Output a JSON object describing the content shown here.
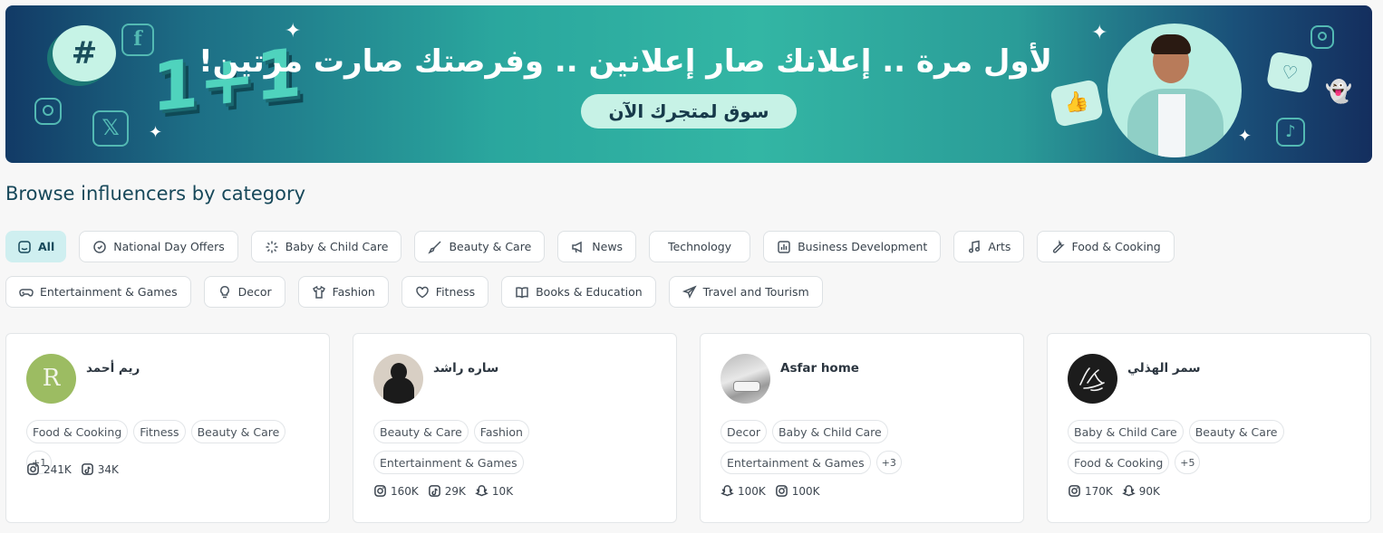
{
  "banner": {
    "headline": "لأول مرة .. إعلانك صار إعلانين .. وفرصتك صارت مرتين!",
    "cta_label": "سوق لمتجرك الآن",
    "promo_badge": "1+1",
    "hash_symbol": "#",
    "social_icons": [
      "facebook-icon",
      "instagram-icon",
      "x-icon",
      "snapchat-icon",
      "tiktok-icon"
    ]
  },
  "section_title": "Browse influencers by category",
  "categories": [
    {
      "label": "All",
      "icon": "grid-smile-icon",
      "active": true
    },
    {
      "label": "National Day Offers",
      "icon": "badge-icon"
    },
    {
      "label": "Baby & Child Care",
      "icon": "loader-icon"
    },
    {
      "label": "Beauty & Care",
      "icon": "brush-icon"
    },
    {
      "label": "News",
      "icon": "megaphone-icon"
    },
    {
      "label": "Technology",
      "icon": ""
    },
    {
      "label": "Business Development",
      "icon": "chart-icon"
    },
    {
      "label": "Arts",
      "icon": "music-icon"
    },
    {
      "label": "Food & Cooking",
      "icon": "wrench-icon"
    },
    {
      "label": "Entertainment & Games",
      "icon": "gamepad-icon"
    },
    {
      "label": "Decor",
      "icon": "bulb-icon"
    },
    {
      "label": "Fashion",
      "icon": "shirt-icon"
    },
    {
      "label": "Fitness",
      "icon": "heart-icon"
    },
    {
      "label": "Books & Education",
      "icon": "book-icon"
    },
    {
      "label": "Travel and Tourism",
      "icon": "plane-icon"
    }
  ],
  "influencers": [
    {
      "name": "ريم أحمد",
      "avatar_letter": "R",
      "tags": [
        "Food & Cooking",
        "Fitness",
        "Beauty & Care",
        "+1"
      ],
      "stats": [
        {
          "platform": "instagram",
          "value": "241K"
        },
        {
          "platform": "tiktok",
          "value": "34K"
        }
      ]
    },
    {
      "name": "ساره راشد",
      "tags": [
        "Beauty & Care",
        "Fashion",
        "Entertainment & Games"
      ],
      "stats": [
        {
          "platform": "instagram",
          "value": "160K"
        },
        {
          "platform": "tiktok",
          "value": "29K"
        },
        {
          "platform": "snapchat",
          "value": "10K"
        }
      ]
    },
    {
      "name": "Asfar home",
      "tags": [
        "Decor",
        "Baby & Child Care",
        "Entertainment & Games",
        "+3"
      ],
      "stats": [
        {
          "platform": "snapchat",
          "value": "100K"
        },
        {
          "platform": "instagram",
          "value": "100K"
        }
      ]
    },
    {
      "name": "سمر الهذلي",
      "tags": [
        "Baby & Child Care",
        "Beauty & Care",
        "Food & Cooking",
        "+5"
      ],
      "stats": [
        {
          "platform": "instagram",
          "value": "170K"
        },
        {
          "platform": "snapchat",
          "value": "90K"
        }
      ]
    }
  ],
  "colors": {
    "accent": "#17485a",
    "chip_active_bg": "#cfeff0",
    "banner_teal": "#33b6a4"
  }
}
